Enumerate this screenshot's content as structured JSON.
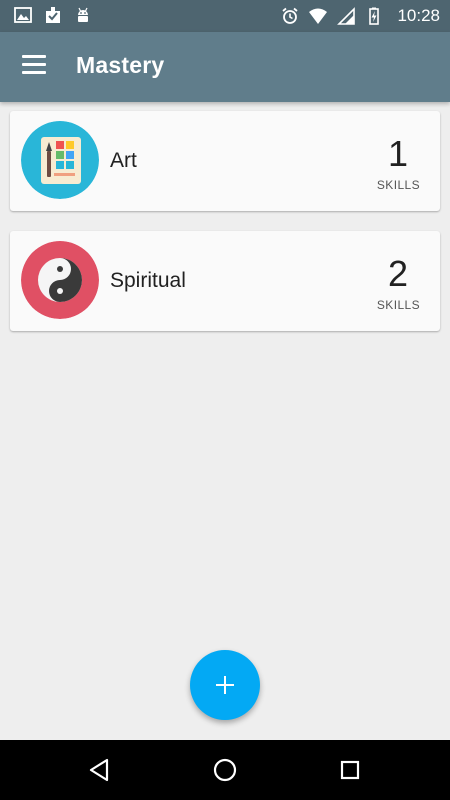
{
  "status_bar": {
    "time": "10:28",
    "left_icons": [
      "image-icon",
      "download-done-icon",
      "android-icon"
    ],
    "right_icons": [
      "alarm-icon",
      "wifi-icon",
      "signal-icon",
      "battery-charging-icon"
    ]
  },
  "app_bar": {
    "title": "Mastery",
    "menu_icon": "menu-icon",
    "color": "#607d8b",
    "status_color": "#4e6570"
  },
  "categories": [
    {
      "name": "Art",
      "count": "1",
      "unit": "SKILLS",
      "icon": "art-palette-icon",
      "color": "#29b6d8"
    },
    {
      "name": "Spiritual",
      "count": "2",
      "unit": "SKILLS",
      "icon": "yin-yang-icon",
      "color": "#e05064"
    }
  ],
  "fab": {
    "label": "+",
    "icon": "add-icon",
    "color": "#03a9f4"
  },
  "nav_bar": {
    "buttons": [
      "back-icon",
      "home-icon",
      "recents-icon"
    ]
  }
}
